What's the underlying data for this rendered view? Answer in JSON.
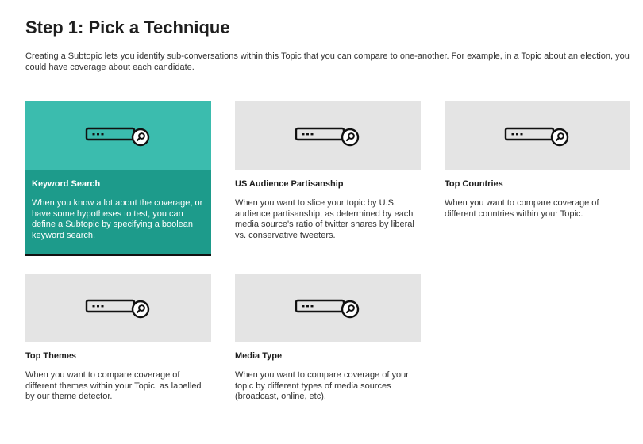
{
  "header": {
    "title": "Step 1: Pick a Technique",
    "intro": "Creating a Subtopic lets you identify sub-conversations within this Topic that you can compare to one-another. For example, in a Topic about an election, you could have coverage about each candidate."
  },
  "techniques": [
    {
      "name": "Keyword Search",
      "description": "When you know a lot about the coverage, or have some hypotheses to test, you can define a Subtopic by specifying a boolean keyword search.",
      "icon": "search-bar-icon",
      "selected": true
    },
    {
      "name": "US Audience Partisanship",
      "description": "When you want to slice your topic by U.S. audience partisanship, as determined by each media source's ratio of twitter shares by liberal vs. conservative tweeters.",
      "icon": "search-bar-icon",
      "selected": false
    },
    {
      "name": "Top Countries",
      "description": "When you want to compare coverage of different countries within your Topic.",
      "icon": "search-bar-icon",
      "selected": false
    },
    {
      "name": "Top Themes",
      "description": "When you want to compare coverage of different themes within your Topic, as labelled by our theme detector.",
      "icon": "search-bar-icon",
      "selected": false
    },
    {
      "name": "Media Type",
      "description": "When you want to compare coverage of your topic by different types of media sources (broadcast, online, etc).",
      "icon": "search-bar-icon",
      "selected": false
    }
  ],
  "colors": {
    "selected_thumb": "#3bbcae",
    "selected_body": "#1d9b8b",
    "thumb": "#e4e4e4",
    "text": "#333333"
  }
}
